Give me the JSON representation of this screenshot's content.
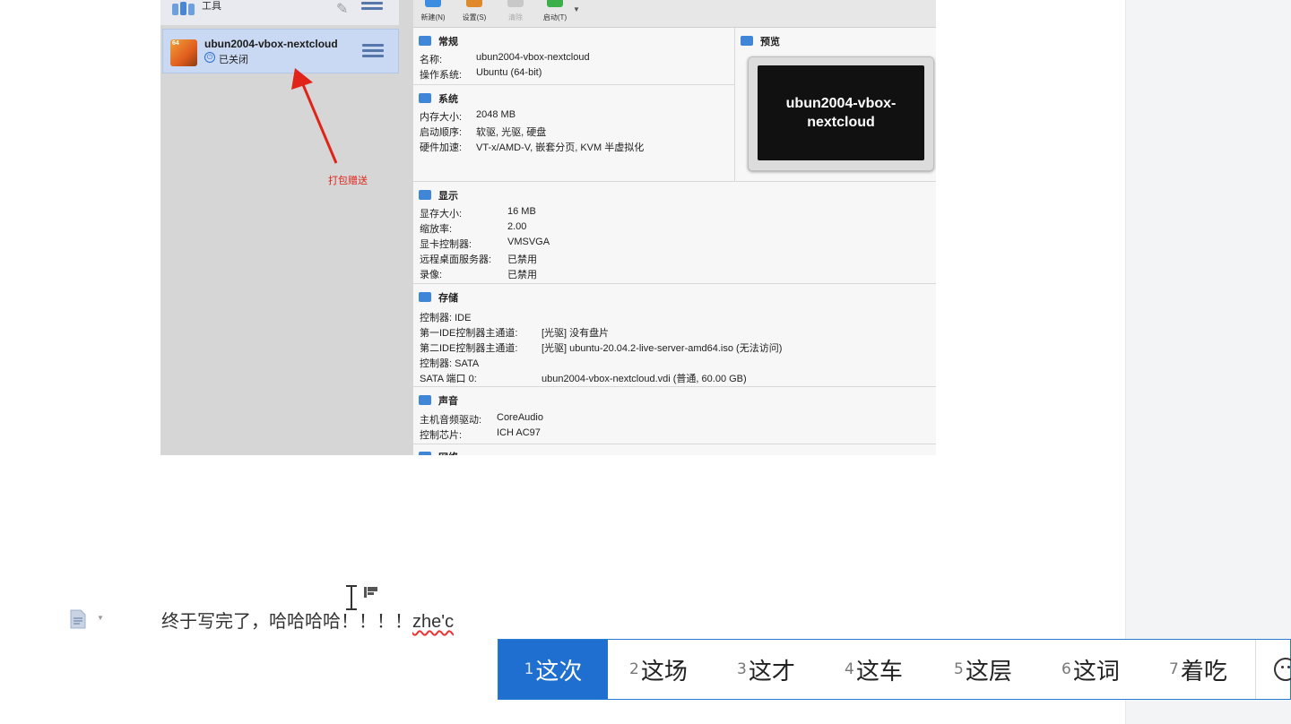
{
  "vbox": {
    "tools_label": "工具",
    "vm": {
      "name": "ubun2004-vbox-nextcloud",
      "state": "已关闭",
      "os_badge": "64"
    },
    "annotation": "打包赠送",
    "toolbar": [
      {
        "label": "新建(N)",
        "icon": "new-icon",
        "color": "#3a8de0"
      },
      {
        "label": "设置(S)",
        "icon": "settings-icon",
        "color": "#e0892a"
      },
      {
        "label": "清除",
        "icon": "discard-icon",
        "color": "#c8c8c8"
      },
      {
        "label": "启动(T)",
        "icon": "start-icon",
        "color": "#3bb04a"
      }
    ],
    "general": {
      "title": "常规",
      "rows": [
        {
          "k": "名称:",
          "v": "ubun2004-vbox-nextcloud"
        },
        {
          "k": "操作系统:",
          "v": "Ubuntu (64-bit)"
        }
      ]
    },
    "system": {
      "title": "系统",
      "rows": [
        {
          "k": "内存大小:",
          "v": "2048 MB"
        },
        {
          "k": "启动顺序:",
          "v": "软驱, 光驱, 硬盘"
        },
        {
          "k": "硬件加速:",
          "v": "VT-x/AMD-V, 嵌套分页, KVM 半虚拟化"
        }
      ]
    },
    "preview": {
      "title": "预览",
      "screen_text": "ubun2004-vbox-nextcloud"
    },
    "display": {
      "title": "显示",
      "rows": [
        {
          "k": "显存大小:",
          "v": "16 MB"
        },
        {
          "k": "缩放率:",
          "v": "2.00"
        },
        {
          "k": "显卡控制器:",
          "v": "VMSVGA"
        },
        {
          "k": "远程桌面服务器:",
          "v": "已禁用"
        },
        {
          "k": "录像:",
          "v": "已禁用"
        }
      ]
    },
    "storage": {
      "title": "存储",
      "rows": [
        {
          "k": "控制器: IDE",
          "v": ""
        },
        {
          "k": " 第一IDE控制器主通道:",
          "v": "[光驱] 没有盘片"
        },
        {
          "k": " 第二IDE控制器主通道:",
          "v": "[光驱] ubuntu-20.04.2-live-server-amd64.iso (无法访问)"
        },
        {
          "k": "控制器: SATA",
          "v": ""
        },
        {
          "k": " SATA 端口 0:",
          "v": "ubun2004-vbox-nextcloud.vdi (普通, 60.00 GB)"
        }
      ]
    },
    "audio": {
      "title": "声音",
      "rows": [
        {
          "k": "主机音频驱动:",
          "v": "CoreAudio"
        },
        {
          "k": "控制芯片:",
          "v": "ICH AC97"
        }
      ]
    },
    "network": {
      "title": "网络"
    }
  },
  "editor": {
    "line_text": "终于写完了，哈哈哈哈！！！！",
    "pinyin": "zhe'c"
  },
  "ime": {
    "candidates": [
      {
        "n": "1",
        "text": "这次"
      },
      {
        "n": "2",
        "text": "这场"
      },
      {
        "n": "3",
        "text": "这才"
      },
      {
        "n": "4",
        "text": "这车"
      },
      {
        "n": "5",
        "text": "这层"
      },
      {
        "n": "6",
        "text": "这词"
      },
      {
        "n": "7",
        "text": "着吃"
      }
    ],
    "selected_index": 0
  }
}
